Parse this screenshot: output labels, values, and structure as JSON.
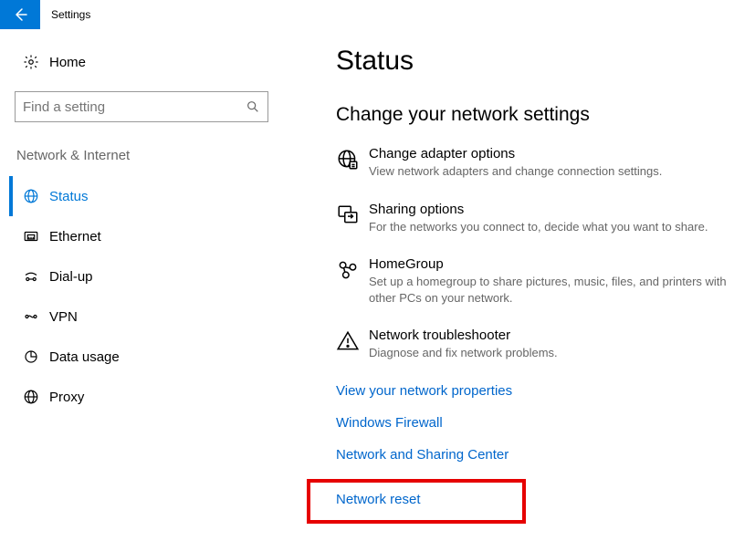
{
  "app": {
    "title": "Settings"
  },
  "sidebar": {
    "home_label": "Home",
    "search_placeholder": "Find a setting",
    "category": "Network & Internet",
    "items": [
      {
        "label": "Status"
      },
      {
        "label": "Ethernet"
      },
      {
        "label": "Dial-up"
      },
      {
        "label": "VPN"
      },
      {
        "label": "Data usage"
      },
      {
        "label": "Proxy"
      }
    ]
  },
  "main": {
    "page_title": "Status",
    "section_heading": "Change your network settings",
    "settings": [
      {
        "title": "Change adapter options",
        "desc": "View network adapters and change connection settings."
      },
      {
        "title": "Sharing options",
        "desc": "For the networks you connect to, decide what you want to share."
      },
      {
        "title": "HomeGroup",
        "desc": "Set up a homegroup to share pictures, music, files, and printers with other PCs on your network."
      },
      {
        "title": "Network troubleshooter",
        "desc": "Diagnose and fix network problems."
      }
    ],
    "links": [
      "View your network properties",
      "Windows Firewall",
      "Network and Sharing Center",
      "Network reset"
    ]
  }
}
